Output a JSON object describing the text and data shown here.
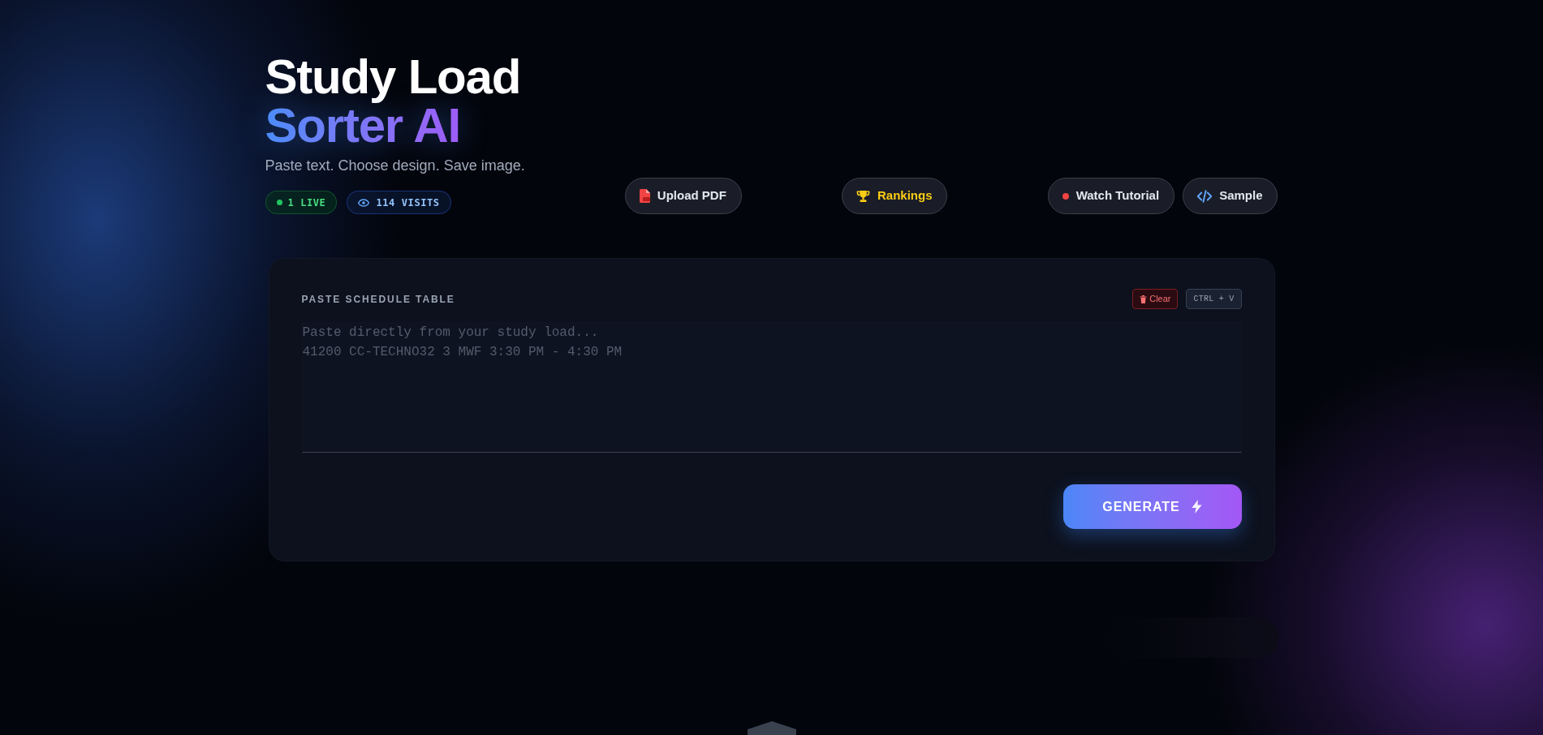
{
  "header": {
    "title": "Study Load",
    "title_accent": "Sorter AI",
    "subtitle": "Paste text. Choose design. Save image.",
    "badges": [
      {
        "kind": "live",
        "label": "1 LIVE"
      },
      {
        "kind": "visits",
        "label": "114 VISITS"
      }
    ]
  },
  "toolbar_groups": [
    [
      {
        "kind": "pdf",
        "label": "Upload PDF"
      }
    ],
    [
      {
        "kind": "trophy",
        "label": "Rankings"
      }
    ],
    [
      {
        "kind": "video",
        "label": "Watch Tutorial"
      },
      {
        "kind": "code",
        "label": "Sample"
      }
    ]
  ],
  "editor": {
    "label": "PASTE SCHEDULE TABLE",
    "clear_button": "Clear",
    "shortcut": "CTRL + V",
    "placeholder": "Paste directly from your study load...\n41200 CC-TECHNO32 3 MWF 3:30 PM - 4:30 PM",
    "generate_button": "GENERATE"
  }
}
